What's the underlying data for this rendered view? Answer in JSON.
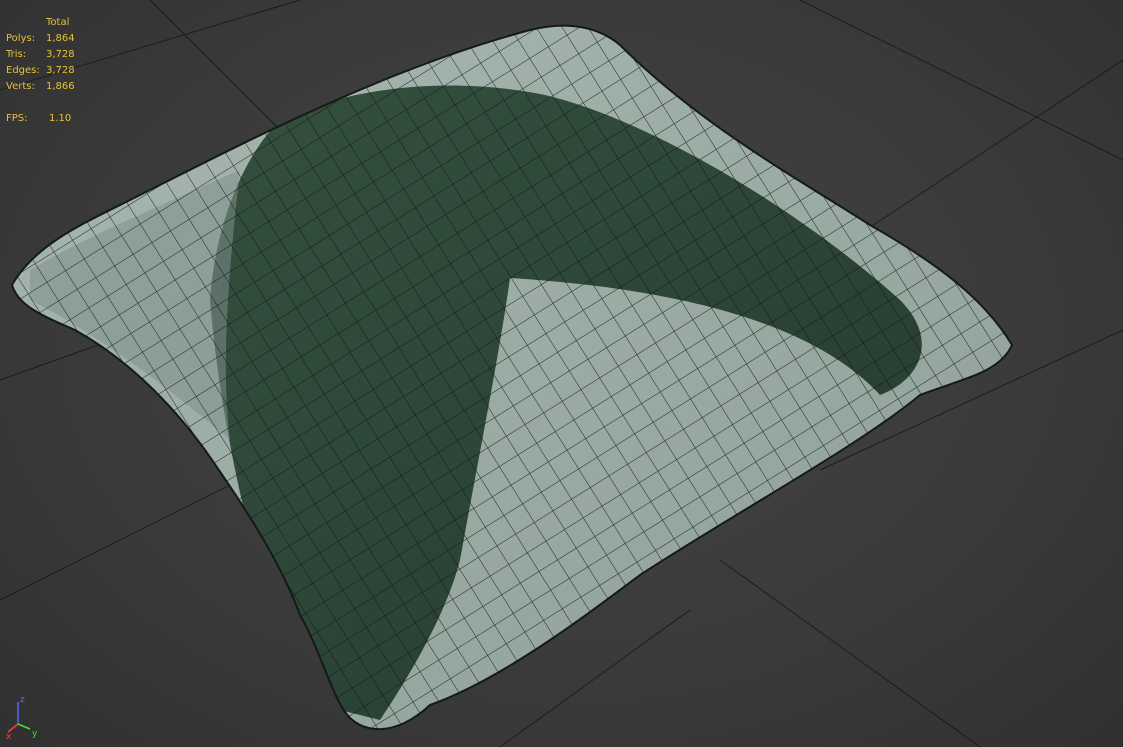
{
  "stats": {
    "total_label": "Total",
    "rows": [
      {
        "label": "Polys:",
        "value": "1,864"
      },
      {
        "label": "Tris:",
        "value": "3,728"
      },
      {
        "label": "Edges:",
        "value": "3,728"
      },
      {
        "label": "Verts:",
        "value": "1,866"
      }
    ],
    "fps_label": "FPS:",
    "fps_value": "1.10"
  },
  "axis_gizmo": {
    "x": "x",
    "y": "y",
    "z": "z"
  },
  "colors": {
    "background": "#3b3b3b",
    "grid": "#1c1c1c",
    "stats_text": "#e6c23a",
    "fabric_light": "#9fb3aa",
    "fabric_dark": "#2f4a3d"
  }
}
